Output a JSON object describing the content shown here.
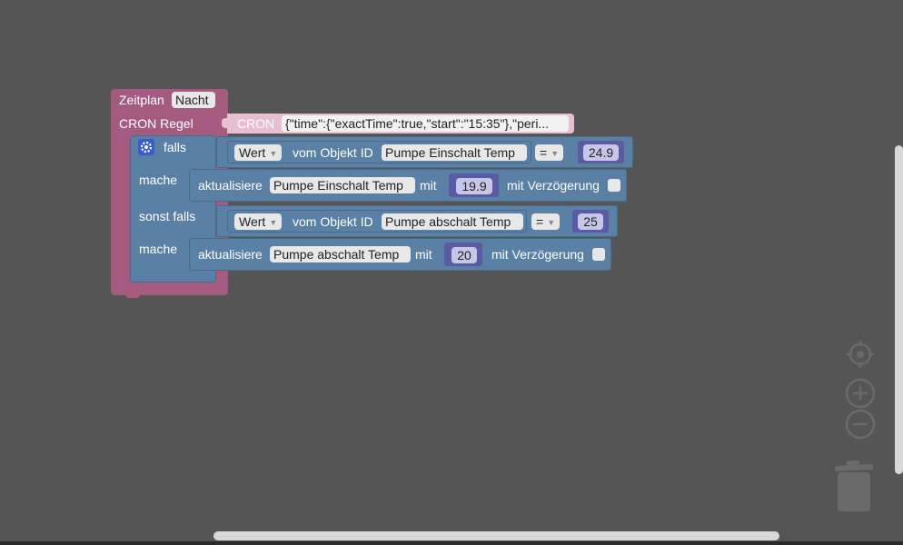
{
  "schedule": {
    "label": "Zeitplan",
    "name": "Nacht",
    "cron_label": "CRON Regel",
    "cron_block_label": "CRON",
    "cron_value": "{\"time\":{\"exactTime\":true,\"start\":\"15:35\"},\"peri..."
  },
  "if_block": {
    "if_label": "falls",
    "do_label": "mache",
    "else_if_label": "sonst falls",
    "do2_label": "mache"
  },
  "condition1": {
    "value_dropdown": "Wert",
    "of_object_label": "vom Objekt ID",
    "object": "Pumpe Einschalt Temp",
    "operator": "=",
    "number": "24.9"
  },
  "action1": {
    "update_label": "aktualisiere",
    "object": "Pumpe Einschalt Temp",
    "with_label": "mit",
    "number": "19.9",
    "delay_label": "mit Verzögerung",
    "delay_checked": false
  },
  "condition2": {
    "value_dropdown": "Wert",
    "of_object_label": "vom Objekt ID",
    "object": "Pumpe abschalt Temp",
    "operator": "=",
    "number": "25"
  },
  "action2": {
    "update_label": "aktualisiere",
    "object": "Pumpe abschalt Temp",
    "with_label": "mit",
    "number": "20",
    "delay_label": "mit Verzögerung",
    "delay_checked": false
  },
  "controls": {
    "recenter_icon": "crosshair-icon",
    "zoom_in_icon": "plus-circle-icon",
    "zoom_out_icon": "minus-circle-icon",
    "trash_icon": "trash-icon"
  },
  "colors": {
    "workspace": "#555555",
    "schedule_block": "#a55b80",
    "logic_block": "#5b80a5",
    "number_block": "#5b5ba5"
  }
}
